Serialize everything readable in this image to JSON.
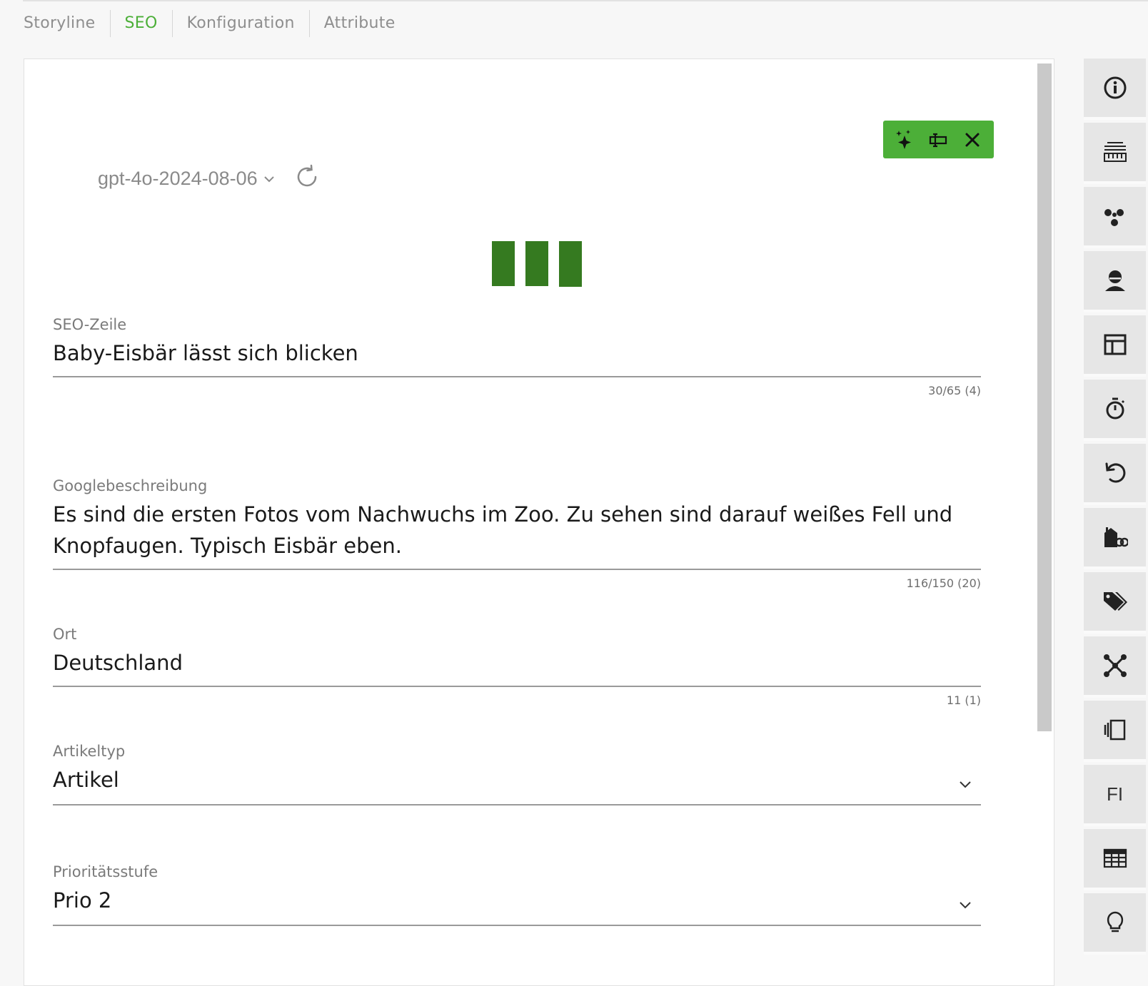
{
  "tabs": [
    {
      "label": "Storyline",
      "active": false
    },
    {
      "label": "SEO",
      "active": true
    },
    {
      "label": "Konfiguration",
      "active": false
    },
    {
      "label": "Attribute",
      "active": false
    }
  ],
  "ai_toolbar": {
    "icons": [
      "sparkles-icon",
      "tag-input-icon",
      "close-icon"
    ]
  },
  "model": {
    "name": "gpt-4o-2024-08-06",
    "icons": [
      "chevron-down-icon",
      "refresh-icon"
    ]
  },
  "fields": {
    "seo_line": {
      "label": "SEO-Zeile",
      "value": "Baby-Eisbär lässt sich blicken",
      "counter": "30/65 (4)"
    },
    "google_description": {
      "label": "Googlebeschreibung",
      "value": "Es sind die ersten Fotos vom Nachwuchs im Zoo. Zu sehen sind darauf weißes Fell und Knopfaugen. Typisch Eisbär eben.",
      "counter": "116/150 (20)"
    },
    "location": {
      "label": "Ort",
      "value": "Deutschland",
      "counter": "11 (1)"
    },
    "article_type": {
      "label": "Artikeltyp",
      "value": "Artikel"
    },
    "priority": {
      "label": "Prioritätsstufe",
      "value": "Prio 2"
    }
  },
  "sidebar": {
    "icons": [
      "info-icon",
      "keyboard-icon",
      "share-icon",
      "user-icon",
      "layout-icon",
      "timer-icon",
      "undo-icon",
      "house-link-icon",
      "tags-icon",
      "network-icon",
      "pages-icon",
      "fi-text",
      "table-icon",
      "bulb-icon"
    ],
    "fi_label": "FI"
  },
  "colors": {
    "accent": "#4caf38",
    "loader": "#357a20",
    "sidebar_bg": "#e6e6e6"
  }
}
